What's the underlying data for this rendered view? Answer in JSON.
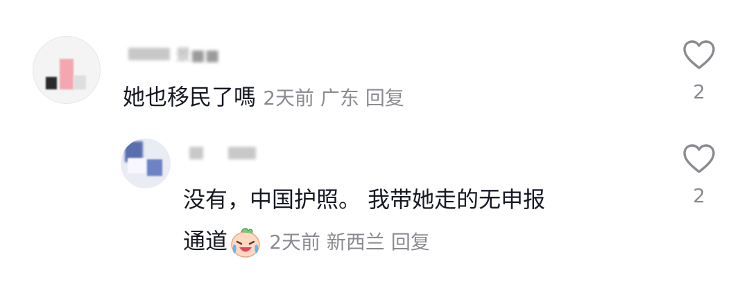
{
  "comments": [
    {
      "username": "景■■",
      "text": "她也移民了嗎",
      "time": "2天前",
      "location": "广东",
      "reply_label": "回复",
      "likes": "2"
    },
    {
      "username": "■ ■■■",
      "text_line1": "没有，中国护照。 我带她走的无申报",
      "text_line2": "通道",
      "emoji": "crying-laughing-emoji",
      "time": "2天前",
      "location": "新西兰",
      "reply_label": "回复",
      "likes": "2"
    }
  ],
  "icons": {
    "like": "heart-outline-icon",
    "like_color": "#8a8b91"
  }
}
